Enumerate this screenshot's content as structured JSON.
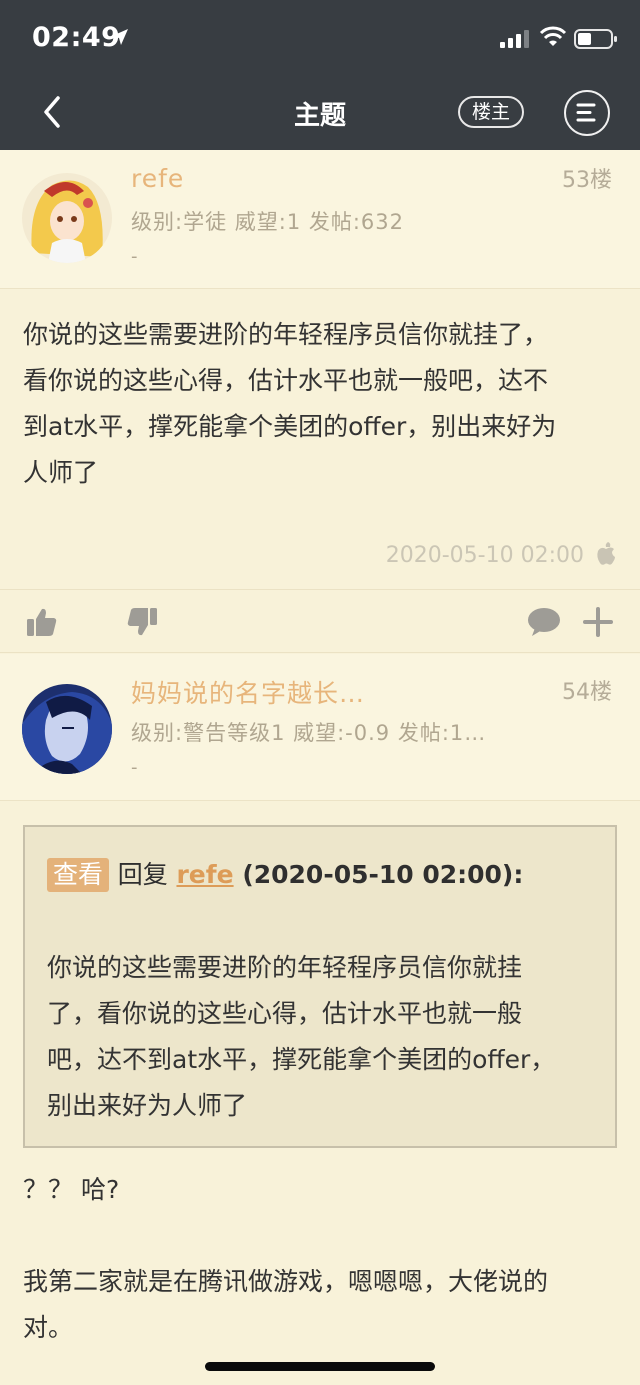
{
  "status_bar": {
    "time": "02:49"
  },
  "nav": {
    "title": "主题",
    "op_label": "楼主"
  },
  "posts": [
    {
      "username": "refe",
      "floor": "53楼",
      "meta": "级别:学徒   威望:1   发帖:632",
      "signature": "-",
      "content_lines": [
        "你说的这些需要进阶的年轻程序员信你就挂了，",
        "看你说的这些心得，估计水平也就一般吧，达不",
        "到at水平，撑死能拿个美团的offer，别出来好为",
        "人师了"
      ],
      "time": "2020-05-10 02:00"
    },
    {
      "username": "妈妈说的名字越长…",
      "floor": "54楼",
      "meta": "级别:警告等级1   威望:-0.9   发帖:1…",
      "signature": "-",
      "quote": {
        "view_label": "查看",
        "reply_label": "回复",
        "user": "refe",
        "time": "(2020-05-10 02:00):",
        "lines": [
          "你说的这些需要进阶的年轻程序员信你就挂",
          "了，看你说的这些心得，估计水平也就一般",
          "吧，达不到at水平，撑死能拿个美团的offer，",
          "别出来好为人师了"
        ]
      },
      "reply_lines": [
        "？？ 哈?",
        "",
        "我第二家就是在腾讯做游戏，嗯嗯嗯，大佬说的",
        "对。"
      ]
    }
  ],
  "icons": {
    "back": "chevron-left-icon",
    "menu": "menu-icon",
    "like": "thumbs-up-icon",
    "dislike": "thumbs-down-icon",
    "comment": "comment-icon",
    "more": "plus-icon",
    "device": "apple-icon"
  },
  "colors": {
    "topbar": "#383d42",
    "background": "#f8f2d9",
    "username": "#e7b57b",
    "quote_tag": "#e4b27a",
    "quote_bg": "#ede6cb"
  }
}
